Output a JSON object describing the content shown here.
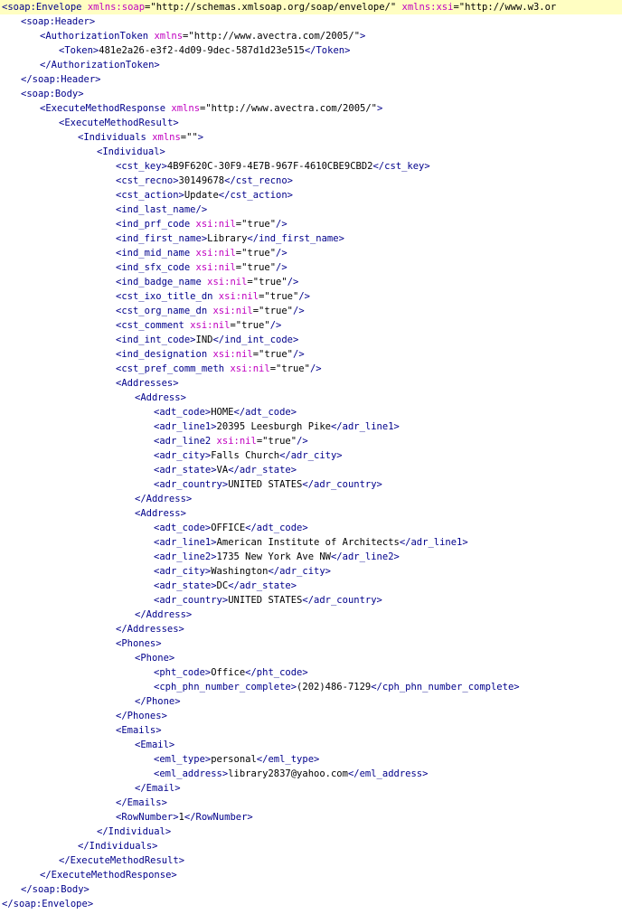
{
  "colors": {
    "tag": "#00008b",
    "attribute": "#c000c0",
    "text": "#000000",
    "highlight_line": "#fffec2",
    "background": "#ffffff"
  },
  "lines": [
    {
      "indent": 0,
      "highlight": true,
      "tokens": [
        {
          "t": "tag",
          "v": "<soap:Envelope "
        },
        {
          "t": "attr",
          "v": "xmlns:soap"
        },
        {
          "t": "val",
          "v": "=\"http://schemas.xmlsoap.org/soap/envelope/\" "
        },
        {
          "t": "attr",
          "v": "xmlns:xsi"
        },
        {
          "t": "val",
          "v": "=\"http://www.w3.or"
        }
      ]
    },
    {
      "indent": 1,
      "tokens": [
        {
          "t": "tag",
          "v": "<soap:Header>"
        }
      ]
    },
    {
      "indent": 2,
      "tokens": [
        {
          "t": "tag",
          "v": "<AuthorizationToken "
        },
        {
          "t": "attr",
          "v": "xmlns"
        },
        {
          "t": "val",
          "v": "=\"http://www.avectra.com/2005/\""
        },
        {
          "t": "tag",
          "v": ">"
        }
      ]
    },
    {
      "indent": 3,
      "tokens": [
        {
          "t": "tag",
          "v": "<Token>"
        },
        {
          "t": "txt",
          "v": "481e2a26-e3f2-4d09-9dec-587d1d23e515"
        },
        {
          "t": "tag",
          "v": "</Token>"
        }
      ]
    },
    {
      "indent": 2,
      "tokens": [
        {
          "t": "tag",
          "v": "</AuthorizationToken>"
        }
      ]
    },
    {
      "indent": 1,
      "tokens": [
        {
          "t": "tag",
          "v": "</soap:Header>"
        }
      ]
    },
    {
      "indent": 1,
      "tokens": [
        {
          "t": "tag",
          "v": "<soap:Body>"
        }
      ]
    },
    {
      "indent": 2,
      "tokens": [
        {
          "t": "tag",
          "v": "<ExecuteMethodResponse "
        },
        {
          "t": "attr",
          "v": "xmlns"
        },
        {
          "t": "val",
          "v": "=\"http://www.avectra.com/2005/\""
        },
        {
          "t": "tag",
          "v": ">"
        }
      ]
    },
    {
      "indent": 3,
      "tokens": [
        {
          "t": "tag",
          "v": "<ExecuteMethodResult>"
        }
      ]
    },
    {
      "indent": 4,
      "tokens": [
        {
          "t": "tag",
          "v": "<Individuals "
        },
        {
          "t": "attr",
          "v": "xmlns"
        },
        {
          "t": "val",
          "v": "=\"\""
        },
        {
          "t": "tag",
          "v": ">"
        }
      ]
    },
    {
      "indent": 5,
      "tokens": [
        {
          "t": "tag",
          "v": "<Individual>"
        }
      ]
    },
    {
      "indent": 6,
      "tokens": [
        {
          "t": "tag",
          "v": "<cst_key>"
        },
        {
          "t": "txt",
          "v": "4B9F620C-30F9-4E7B-967F-4610CBE9CBD2"
        },
        {
          "t": "tag",
          "v": "</cst_key>"
        }
      ]
    },
    {
      "indent": 6,
      "tokens": [
        {
          "t": "tag",
          "v": "<cst_recno>"
        },
        {
          "t": "txt",
          "v": "30149678"
        },
        {
          "t": "tag",
          "v": "</cst_recno>"
        }
      ]
    },
    {
      "indent": 6,
      "tokens": [
        {
          "t": "tag",
          "v": "<cst_action>"
        },
        {
          "t": "txt",
          "v": "Update"
        },
        {
          "t": "tag",
          "v": "</cst_action>"
        }
      ]
    },
    {
      "indent": 6,
      "tokens": [
        {
          "t": "tag",
          "v": "<ind_last_name/>"
        }
      ]
    },
    {
      "indent": 6,
      "tokens": [
        {
          "t": "tag",
          "v": "<ind_prf_code "
        },
        {
          "t": "attr",
          "v": "xsi:nil"
        },
        {
          "t": "val",
          "v": "=\"true\""
        },
        {
          "t": "tag",
          "v": "/>"
        }
      ]
    },
    {
      "indent": 6,
      "tokens": [
        {
          "t": "tag",
          "v": "<ind_first_name>"
        },
        {
          "t": "txt",
          "v": "Library"
        },
        {
          "t": "tag",
          "v": "</ind_first_name>"
        }
      ]
    },
    {
      "indent": 6,
      "tokens": [
        {
          "t": "tag",
          "v": "<ind_mid_name "
        },
        {
          "t": "attr",
          "v": "xsi:nil"
        },
        {
          "t": "val",
          "v": "=\"true\""
        },
        {
          "t": "tag",
          "v": "/>"
        }
      ]
    },
    {
      "indent": 6,
      "tokens": [
        {
          "t": "tag",
          "v": "<ind_sfx_code "
        },
        {
          "t": "attr",
          "v": "xsi:nil"
        },
        {
          "t": "val",
          "v": "=\"true\""
        },
        {
          "t": "tag",
          "v": "/>"
        }
      ]
    },
    {
      "indent": 6,
      "tokens": [
        {
          "t": "tag",
          "v": "<ind_badge_name "
        },
        {
          "t": "attr",
          "v": "xsi:nil"
        },
        {
          "t": "val",
          "v": "=\"true\""
        },
        {
          "t": "tag",
          "v": "/>"
        }
      ]
    },
    {
      "indent": 6,
      "tokens": [
        {
          "t": "tag",
          "v": "<cst_ixo_title_dn "
        },
        {
          "t": "attr",
          "v": "xsi:nil"
        },
        {
          "t": "val",
          "v": "=\"true\""
        },
        {
          "t": "tag",
          "v": "/>"
        }
      ]
    },
    {
      "indent": 6,
      "tokens": [
        {
          "t": "tag",
          "v": "<cst_org_name_dn "
        },
        {
          "t": "attr",
          "v": "xsi:nil"
        },
        {
          "t": "val",
          "v": "=\"true\""
        },
        {
          "t": "tag",
          "v": "/>"
        }
      ]
    },
    {
      "indent": 6,
      "tokens": [
        {
          "t": "tag",
          "v": "<cst_comment "
        },
        {
          "t": "attr",
          "v": "xsi:nil"
        },
        {
          "t": "val",
          "v": "=\"true\""
        },
        {
          "t": "tag",
          "v": "/>"
        }
      ]
    },
    {
      "indent": 6,
      "tokens": [
        {
          "t": "tag",
          "v": "<ind_int_code>"
        },
        {
          "t": "txt",
          "v": "IND"
        },
        {
          "t": "tag",
          "v": "</ind_int_code>"
        }
      ]
    },
    {
      "indent": 6,
      "tokens": [
        {
          "t": "tag",
          "v": "<ind_designation "
        },
        {
          "t": "attr",
          "v": "xsi:nil"
        },
        {
          "t": "val",
          "v": "=\"true\""
        },
        {
          "t": "tag",
          "v": "/>"
        }
      ]
    },
    {
      "indent": 6,
      "tokens": [
        {
          "t": "tag",
          "v": "<cst_pref_comm_meth "
        },
        {
          "t": "attr",
          "v": "xsi:nil"
        },
        {
          "t": "val",
          "v": "=\"true\""
        },
        {
          "t": "tag",
          "v": "/>"
        }
      ]
    },
    {
      "indent": 6,
      "tokens": [
        {
          "t": "tag",
          "v": "<Addresses>"
        }
      ]
    },
    {
      "indent": 7,
      "tokens": [
        {
          "t": "tag",
          "v": "<Address>"
        }
      ]
    },
    {
      "indent": 8,
      "tokens": [
        {
          "t": "tag",
          "v": "<adt_code>"
        },
        {
          "t": "txt",
          "v": "HOME"
        },
        {
          "t": "tag",
          "v": "</adt_code>"
        }
      ]
    },
    {
      "indent": 8,
      "tokens": [
        {
          "t": "tag",
          "v": "<adr_line1>"
        },
        {
          "t": "txt",
          "v": "20395 Leesburgh Pike"
        },
        {
          "t": "tag",
          "v": "</adr_line1>"
        }
      ]
    },
    {
      "indent": 8,
      "tokens": [
        {
          "t": "tag",
          "v": "<adr_line2 "
        },
        {
          "t": "attr",
          "v": "xsi:nil"
        },
        {
          "t": "val",
          "v": "=\"true\""
        },
        {
          "t": "tag",
          "v": "/>"
        }
      ]
    },
    {
      "indent": 8,
      "tokens": [
        {
          "t": "tag",
          "v": "<adr_city>"
        },
        {
          "t": "txt",
          "v": "Falls Church"
        },
        {
          "t": "tag",
          "v": "</adr_city>"
        }
      ]
    },
    {
      "indent": 8,
      "tokens": [
        {
          "t": "tag",
          "v": "<adr_state>"
        },
        {
          "t": "txt",
          "v": "VA"
        },
        {
          "t": "tag",
          "v": "</adr_state>"
        }
      ]
    },
    {
      "indent": 8,
      "tokens": [
        {
          "t": "tag",
          "v": "<adr_country>"
        },
        {
          "t": "txt",
          "v": "UNITED STATES"
        },
        {
          "t": "tag",
          "v": "</adr_country>"
        }
      ]
    },
    {
      "indent": 7,
      "tokens": [
        {
          "t": "tag",
          "v": "</Address>"
        }
      ]
    },
    {
      "indent": 7,
      "tokens": [
        {
          "t": "tag",
          "v": "<Address>"
        }
      ]
    },
    {
      "indent": 8,
      "tokens": [
        {
          "t": "tag",
          "v": "<adt_code>"
        },
        {
          "t": "txt",
          "v": "OFFICE"
        },
        {
          "t": "tag",
          "v": "</adt_code>"
        }
      ]
    },
    {
      "indent": 8,
      "tokens": [
        {
          "t": "tag",
          "v": "<adr_line1>"
        },
        {
          "t": "txt",
          "v": "American Institute of Architects"
        },
        {
          "t": "tag",
          "v": "</adr_line1>"
        }
      ]
    },
    {
      "indent": 8,
      "tokens": [
        {
          "t": "tag",
          "v": "<adr_line2>"
        },
        {
          "t": "txt",
          "v": "1735 New York Ave NW"
        },
        {
          "t": "tag",
          "v": "</adr_line2>"
        }
      ]
    },
    {
      "indent": 8,
      "tokens": [
        {
          "t": "tag",
          "v": "<adr_city>"
        },
        {
          "t": "txt",
          "v": "Washington"
        },
        {
          "t": "tag",
          "v": "</adr_city>"
        }
      ]
    },
    {
      "indent": 8,
      "tokens": [
        {
          "t": "tag",
          "v": "<adr_state>"
        },
        {
          "t": "txt",
          "v": "DC"
        },
        {
          "t": "tag",
          "v": "</adr_state>"
        }
      ]
    },
    {
      "indent": 8,
      "tokens": [
        {
          "t": "tag",
          "v": "<adr_country>"
        },
        {
          "t": "txt",
          "v": "UNITED STATES"
        },
        {
          "t": "tag",
          "v": "</adr_country>"
        }
      ]
    },
    {
      "indent": 7,
      "tokens": [
        {
          "t": "tag",
          "v": "</Address>"
        }
      ]
    },
    {
      "indent": 6,
      "tokens": [
        {
          "t": "tag",
          "v": "</Addresses>"
        }
      ]
    },
    {
      "indent": 6,
      "tokens": [
        {
          "t": "tag",
          "v": "<Phones>"
        }
      ]
    },
    {
      "indent": 7,
      "tokens": [
        {
          "t": "tag",
          "v": "<Phone>"
        }
      ]
    },
    {
      "indent": 8,
      "tokens": [
        {
          "t": "tag",
          "v": "<pht_code>"
        },
        {
          "t": "txt",
          "v": "Office"
        },
        {
          "t": "tag",
          "v": "</pht_code>"
        }
      ]
    },
    {
      "indent": 8,
      "tokens": [
        {
          "t": "tag",
          "v": "<cph_phn_number_complete>"
        },
        {
          "t": "txt",
          "v": "(202)486-7129"
        },
        {
          "t": "tag",
          "v": "</cph_phn_number_complete>"
        }
      ]
    },
    {
      "indent": 7,
      "tokens": [
        {
          "t": "tag",
          "v": "</Phone>"
        }
      ]
    },
    {
      "indent": 6,
      "tokens": [
        {
          "t": "tag",
          "v": "</Phones>"
        }
      ]
    },
    {
      "indent": 6,
      "tokens": [
        {
          "t": "tag",
          "v": "<Emails>"
        }
      ]
    },
    {
      "indent": 7,
      "tokens": [
        {
          "t": "tag",
          "v": "<Email>"
        }
      ]
    },
    {
      "indent": 8,
      "tokens": [
        {
          "t": "tag",
          "v": "<eml_type>"
        },
        {
          "t": "txt",
          "v": "personal"
        },
        {
          "t": "tag",
          "v": "</eml_type>"
        }
      ]
    },
    {
      "indent": 8,
      "tokens": [
        {
          "t": "tag",
          "v": "<eml_address>"
        },
        {
          "t": "txt",
          "v": "library2837@yahoo.com"
        },
        {
          "t": "tag",
          "v": "</eml_address>"
        }
      ]
    },
    {
      "indent": 7,
      "tokens": [
        {
          "t": "tag",
          "v": "</Email>"
        }
      ]
    },
    {
      "indent": 6,
      "tokens": [
        {
          "t": "tag",
          "v": "</Emails>"
        }
      ]
    },
    {
      "indent": 6,
      "tokens": [
        {
          "t": "tag",
          "v": "<RowNumber>"
        },
        {
          "t": "txt",
          "v": "1"
        },
        {
          "t": "tag",
          "v": "</RowNumber>"
        }
      ]
    },
    {
      "indent": 5,
      "tokens": [
        {
          "t": "tag",
          "v": "</Individual>"
        }
      ]
    },
    {
      "indent": 4,
      "tokens": [
        {
          "t": "tag",
          "v": "</Individuals>"
        }
      ]
    },
    {
      "indent": 3,
      "tokens": [
        {
          "t": "tag",
          "v": "</ExecuteMethodResult>"
        }
      ]
    },
    {
      "indent": 2,
      "tokens": [
        {
          "t": "tag",
          "v": "</ExecuteMethodResponse>"
        }
      ]
    },
    {
      "indent": 1,
      "tokens": [
        {
          "t": "tag",
          "v": "</soap:Body>"
        }
      ]
    },
    {
      "indent": 0,
      "tokens": [
        {
          "t": "tag",
          "v": "</soap:Envelope>"
        }
      ]
    }
  ]
}
